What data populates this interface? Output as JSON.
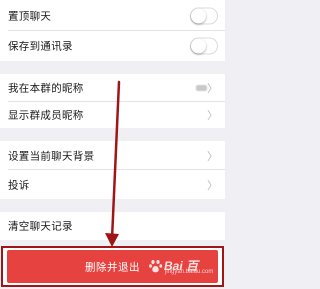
{
  "settings": {
    "sticky_on_top": {
      "label": "置顶聊天",
      "enabled": false,
      "icon": "toggle-switch"
    },
    "save_to_contacts": {
      "label": "保存到通讯录",
      "enabled": false,
      "icon": "toggle-switch"
    },
    "my_group_nickname": {
      "label": "我在本群的昵称",
      "icon": "chevron-right"
    },
    "show_member_nicknames": {
      "label": "显示群成员昵称",
      "icon": "chevron-right"
    },
    "chat_background": {
      "label": "设置当前聊天背景",
      "icon": "chevron-right"
    },
    "report": {
      "label": "投诉",
      "icon": "chevron-right"
    },
    "clear_history": {
      "label": "清空聊天记录"
    }
  },
  "exit_button": {
    "label": "删除并退出",
    "color": "#e64340"
  },
  "annotation": {
    "color": "#a01616",
    "icon": "down-arrow"
  },
  "watermark": {
    "logo": "Bai 百",
    "sub": "jingyan.baidu.com",
    "icon": "paw-icon"
  },
  "colors": {
    "background": "#f0eff4",
    "row": "#ffffff",
    "chevron": "#b8b8bd"
  }
}
